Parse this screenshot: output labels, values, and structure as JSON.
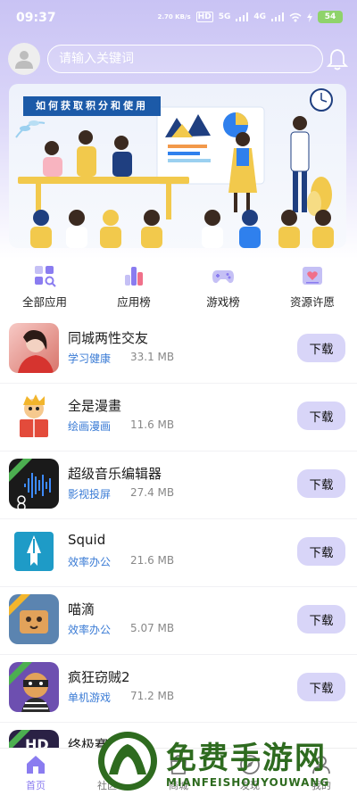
{
  "status": {
    "time": "09:37",
    "net": "2.70 KB/s",
    "hd": "HD",
    "sig1": "5G",
    "sig2": "4G",
    "battery": "54"
  },
  "search": {
    "placeholder": "请输入关键词"
  },
  "banner": {
    "title": "如何获取积分和使用"
  },
  "categories": [
    {
      "label": "全部应用",
      "icon": "grid-search-icon"
    },
    {
      "label": "应用榜",
      "icon": "bar-chart-icon"
    },
    {
      "label": "游戏榜",
      "icon": "gamepad-icon"
    },
    {
      "label": "资源许愿",
      "icon": "wish-card-icon"
    }
  ],
  "apps": [
    {
      "name": "同城两性交友",
      "category": "学习健康",
      "size": "33.1 MB",
      "button": "下载"
    },
    {
      "name": "全是漫畫",
      "category": "绘画漫画",
      "size": "11.6 MB",
      "button": "下载"
    },
    {
      "name": "超级音乐编辑器",
      "category": "影视投屏",
      "size": "27.4 MB",
      "button": "下载"
    },
    {
      "name": "Squid",
      "category": "效率办公",
      "size": "21.6 MB",
      "button": "下载"
    },
    {
      "name": "喵滴",
      "category": "效率办公",
      "size": "5.07 MB",
      "button": "下载"
    },
    {
      "name": "疯狂窃贼2",
      "category": "单机游戏",
      "size": "71.2 MB",
      "button": "下载"
    },
    {
      "name": "终极賽",
      "category": "",
      "size": "",
      "button": ""
    }
  ],
  "nav": [
    {
      "label": "首页"
    },
    {
      "label": "社区"
    },
    {
      "label": "商城"
    },
    {
      "label": "发现"
    },
    {
      "label": "我的"
    }
  ],
  "watermark": {
    "title": "免费手游网",
    "sub": "MIANFEISHOUYOUWANG"
  },
  "colors": {
    "accent": "#8a7cf0",
    "button_bg": "#d8d5f8",
    "category_text": "#3a7bd5",
    "banner_tag": "#1c5aa8"
  }
}
